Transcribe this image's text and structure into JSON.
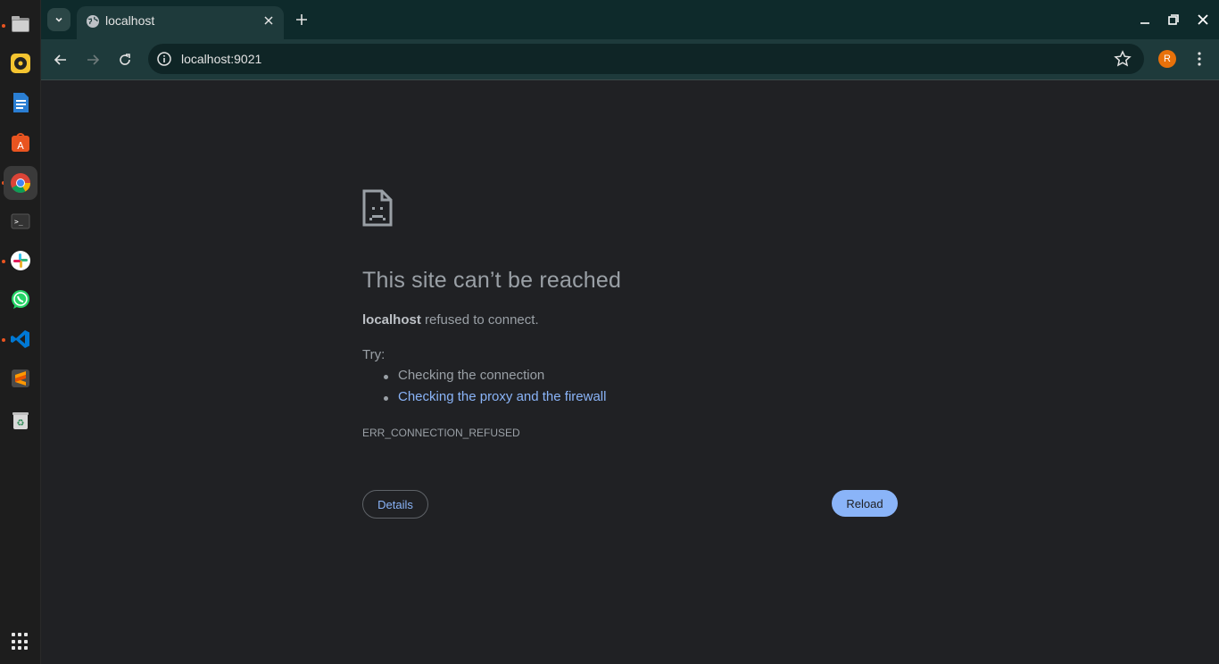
{
  "browser": {
    "tab_title": "localhost",
    "url": "localhost:9021",
    "avatar_letter": "R"
  },
  "error_page": {
    "title": "This site can’t be reached",
    "host": "localhost",
    "message": " refused to connect.",
    "try_label": "Try:",
    "suggestions": [
      "Checking the connection",
      "Checking the proxy and the firewall"
    ],
    "error_code": "ERR_CONNECTION_REFUSED",
    "details_label": "Details",
    "reload_label": "Reload"
  },
  "dock": {
    "apps": [
      "files-icon",
      "rhythmbox-icon",
      "writer-icon",
      "app-center-icon",
      "chrome-icon",
      "terminal-icon",
      "slack-icon",
      "whatsapp-icon",
      "vscode-icon",
      "sublime-icon",
      "trash-icon"
    ],
    "show_apps": "show-apps-icon"
  },
  "colors": {
    "accent": "#8ab4f8",
    "tabbar": "#0e2a2b",
    "toolbar": "#1e3a3b",
    "page_bg": "#202124",
    "avatar": "#e8710a"
  }
}
